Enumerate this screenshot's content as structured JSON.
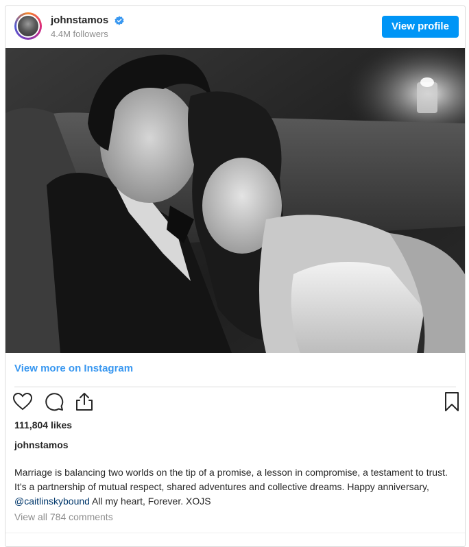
{
  "header": {
    "username": "johnstamos",
    "verified": true,
    "followers": "4.4M followers",
    "view_profile_label": "View profile"
  },
  "post": {
    "photo_alt": "",
    "view_more_label": "View more on Instagram",
    "likes": "111,804 likes",
    "caption_user": "johnstamos",
    "caption_text_1": "Marriage is balancing two worlds on the tip of a promise, a lesson in compromise, a testament to trust. It’s a partnership of mutual respect, shared adventures and collective dreams. Happy anniversary, ",
    "caption_mention": "@caitlinskybound",
    "caption_text_2": " All my heart, Forever. XOJS",
    "view_comments": "View all 784 comments"
  },
  "icons": {
    "like": "heart-icon",
    "comment": "comment-icon",
    "share": "share-icon",
    "save": "bookmark-icon",
    "verified": "verified-badge-icon"
  },
  "colors": {
    "accent": "#0095f6",
    "link": "#3897f0",
    "verified": "#3897f0",
    "muted": "#8e8e8e",
    "mention": "#00376b"
  }
}
